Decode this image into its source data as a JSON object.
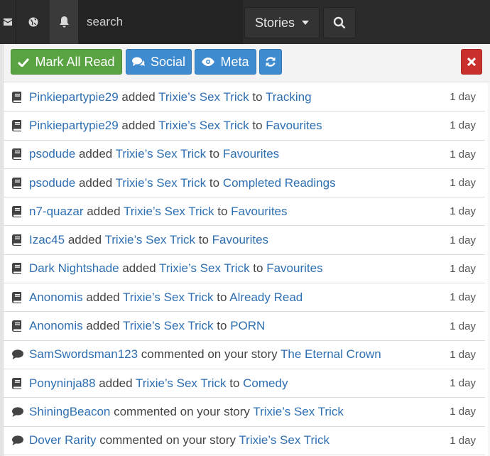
{
  "topbar": {
    "search_placeholder": "search",
    "stories_label": "Stories"
  },
  "toolbar": {
    "mark_all_read": "Mark All Read",
    "social": "Social",
    "meta": "Meta"
  },
  "feed": [
    {
      "type": "add",
      "user": "Pinkiepartypie29",
      "verb": " added ",
      "story": "Trixie’s Sex Trick",
      "conj": " to ",
      "target": "Tracking",
      "time": "1 day"
    },
    {
      "type": "add",
      "user": "Pinkiepartypie29",
      "verb": " added ",
      "story": "Trixie’s Sex Trick",
      "conj": " to ",
      "target": "Favourites",
      "time": "1 day"
    },
    {
      "type": "add",
      "user": "psodude",
      "verb": " added ",
      "story": "Trixie’s Sex Trick",
      "conj": " to ",
      "target": "Favourites",
      "time": "1 day"
    },
    {
      "type": "add",
      "user": "psodude",
      "verb": " added ",
      "story": "Trixie’s Sex Trick",
      "conj": " to ",
      "target": "Completed Readings",
      "time": "1 day"
    },
    {
      "type": "add",
      "user": "n7-quazar",
      "verb": " added ",
      "story": "Trixie’s Sex Trick",
      "conj": " to ",
      "target": "Favourites",
      "time": "1 day"
    },
    {
      "type": "add",
      "user": "Izac45",
      "verb": " added ",
      "story": "Trixie’s Sex Trick",
      "conj": " to ",
      "target": "Favourites",
      "time": "1 day"
    },
    {
      "type": "add",
      "user": "Dark Nightshade",
      "verb": " added ",
      "story": "Trixie’s Sex Trick",
      "conj": " to ",
      "target": "Favourites",
      "time": "1 day"
    },
    {
      "type": "add",
      "user": "Anonomis",
      "verb": " added ",
      "story": "Trixie’s Sex Trick",
      "conj": " to ",
      "target": "Already Read",
      "time": "1 day"
    },
    {
      "type": "add",
      "user": "Anonomis",
      "verb": " added ",
      "story": "Trixie’s Sex Trick",
      "conj": " to ",
      "target": "PORN",
      "time": "1 day"
    },
    {
      "type": "comment",
      "user": "SamSwordsman123",
      "verb": " commented on your story ",
      "story": "The Eternal Crown",
      "conj": "",
      "target": "",
      "time": "1 day"
    },
    {
      "type": "add",
      "user": "Ponyninja88",
      "verb": " added ",
      "story": "Trixie’s Sex Trick",
      "conj": " to ",
      "target": "Comedy",
      "time": "1 day"
    },
    {
      "type": "comment",
      "user": "ShiningBeacon",
      "verb": " commented on your story ",
      "story": "Trixie’s Sex Trick",
      "conj": "",
      "target": "",
      "time": "1 day"
    },
    {
      "type": "comment",
      "user": "Dover Rarity",
      "verb": " commented on your story ",
      "story": "Trixie’s Sex Trick",
      "conj": "",
      "target": "",
      "time": "1 day"
    }
  ]
}
